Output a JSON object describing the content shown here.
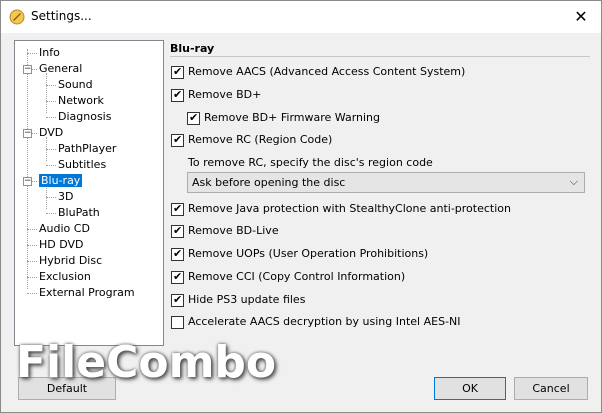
{
  "window": {
    "title": "Settings...",
    "close_glyph": "✕"
  },
  "tree": {
    "items": [
      {
        "label": "Info"
      },
      {
        "label": "General",
        "expander": "−"
      },
      {
        "label": "Sound"
      },
      {
        "label": "Network"
      },
      {
        "label": "Diagnosis"
      },
      {
        "label": "DVD",
        "expander": "−"
      },
      {
        "label": "PathPlayer"
      },
      {
        "label": "Subtitles"
      },
      {
        "label": "Blu-ray",
        "expander": "−",
        "selected": true
      },
      {
        "label": "3D"
      },
      {
        "label": "BluPath"
      },
      {
        "label": "Audio CD"
      },
      {
        "label": "HD DVD"
      },
      {
        "label": "Hybrid Disc"
      },
      {
        "label": "Exclusion"
      },
      {
        "label": "External Program"
      }
    ]
  },
  "panel": {
    "title": "Blu-ray",
    "options": [
      {
        "label": "Remove AACS (Advanced Access Content System)",
        "checked": true
      },
      {
        "label": "Remove BD+",
        "checked": true
      },
      {
        "label": "Remove BD+ Firmware Warning",
        "checked": true
      },
      {
        "label": "Remove RC (Region Code)",
        "checked": true
      },
      {
        "label": "Remove Java protection with StealthyClone anti-protection",
        "checked": true
      },
      {
        "label": "Remove BD-Live",
        "checked": true
      },
      {
        "label": "Remove UOPs (User Operation Prohibitions)",
        "checked": true
      },
      {
        "label": "Remove CCI (Copy Control Information)",
        "checked": true
      },
      {
        "label": "Hide PS3 update files",
        "checked": true
      },
      {
        "label": "Accelerate AACS decryption by using Intel AES-NI",
        "checked": false
      }
    ],
    "region_label": "To remove RC, specify the disc's region code",
    "region_select": {
      "value": "Ask before opening the disc",
      "chevron": "⌵"
    },
    "check_glyph": "✔"
  },
  "buttons": {
    "default": "Default",
    "ok": "OK",
    "cancel": "Cancel"
  },
  "watermark": "FileCombo"
}
